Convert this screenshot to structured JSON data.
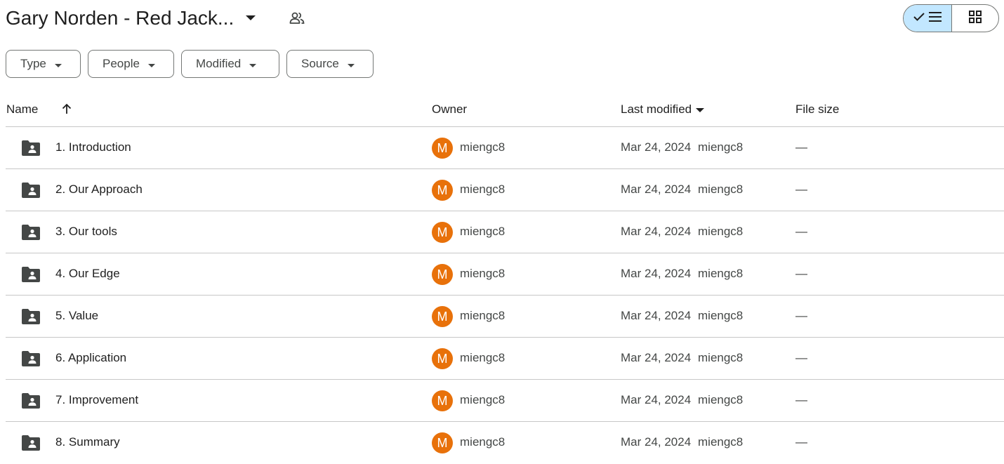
{
  "header": {
    "title": "Gary Norden - Red Jack...",
    "caret_icon": "arrow-drop-down-icon",
    "shared_icon": "people-icon",
    "view_toggle": {
      "list_icons": [
        "check-icon",
        "list-icon"
      ],
      "grid_icon": "grid-icon",
      "active": "list"
    }
  },
  "filters": [
    {
      "label": "Type"
    },
    {
      "label": "People"
    },
    {
      "label": "Modified"
    },
    {
      "label": "Source"
    }
  ],
  "table": {
    "columns": {
      "name": "Name",
      "owner": "Owner",
      "last_modified": "Last modified",
      "file_size": "File size"
    },
    "sort": {
      "name_direction": "ascending",
      "modified_direction": "descending"
    },
    "rows": [
      {
        "name": "1. Introduction",
        "owner_initial": "M",
        "owner": "miengc8",
        "modified_date": "Mar 24, 2024",
        "modified_by": "miengc8",
        "size": "—"
      },
      {
        "name": "2. Our Approach",
        "owner_initial": "M",
        "owner": "miengc8",
        "modified_date": "Mar 24, 2024",
        "modified_by": "miengc8",
        "size": "—"
      },
      {
        "name": "3. Our tools",
        "owner_initial": "M",
        "owner": "miengc8",
        "modified_date": "Mar 24, 2024",
        "modified_by": "miengc8",
        "size": "—"
      },
      {
        "name": "4. Our Edge",
        "owner_initial": "M",
        "owner": "miengc8",
        "modified_date": "Mar 24, 2024",
        "modified_by": "miengc8",
        "size": "—"
      },
      {
        "name": "5. Value",
        "owner_initial": "M",
        "owner": "miengc8",
        "modified_date": "Mar 24, 2024",
        "modified_by": "miengc8",
        "size": "—"
      },
      {
        "name": "6. Application",
        "owner_initial": "M",
        "owner": "miengc8",
        "modified_date": "Mar 24, 2024",
        "modified_by": "miengc8",
        "size": "—"
      },
      {
        "name": "7. Improvement",
        "owner_initial": "M",
        "owner": "miengc8",
        "modified_date": "Mar 24, 2024",
        "modified_by": "miengc8",
        "size": "—"
      },
      {
        "name": "8. Summary",
        "owner_initial": "M",
        "owner": "miengc8",
        "modified_date": "Mar 24, 2024",
        "modified_by": "miengc8",
        "size": "—"
      }
    ]
  },
  "colors": {
    "avatar_bg": "#e8710a",
    "toggle_active_bg": "#c2e7ff",
    "divider": "#c7c7c7",
    "icon": "#444746"
  }
}
